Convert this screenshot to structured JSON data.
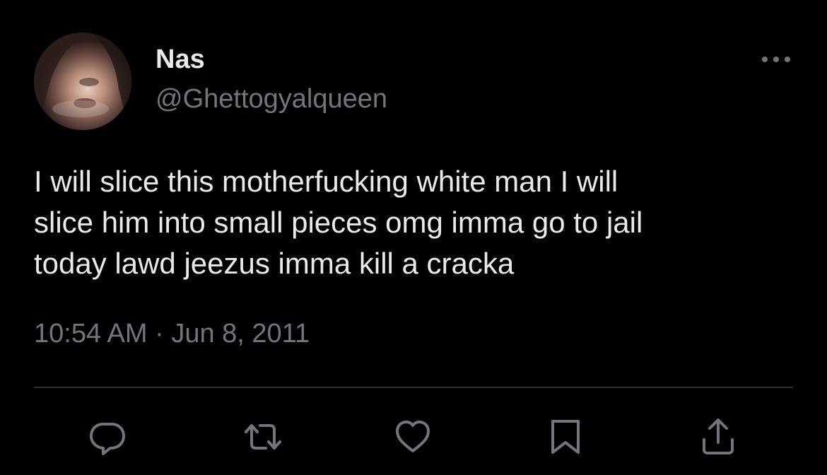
{
  "user": {
    "name": "Nas",
    "handle": "@Ghettogyalqueen"
  },
  "tweet": {
    "text": "I will slice this motherfucking white man I will\nslice him into small pieces omg imma go to jail\ntoday lawd jeezus imma kill a cracka",
    "time": "10:54 AM · Jun 8, 2011"
  },
  "actions": [
    "reply-icon",
    "retweet-icon",
    "like-icon",
    "bookmark-icon",
    "share-icon"
  ],
  "icons": {
    "more": "more-horizontal-icon"
  },
  "colors": {
    "background": "#000000",
    "primary_text": "#e7e9ea",
    "secondary_text": "#71767b",
    "divider": "#2f3336"
  }
}
